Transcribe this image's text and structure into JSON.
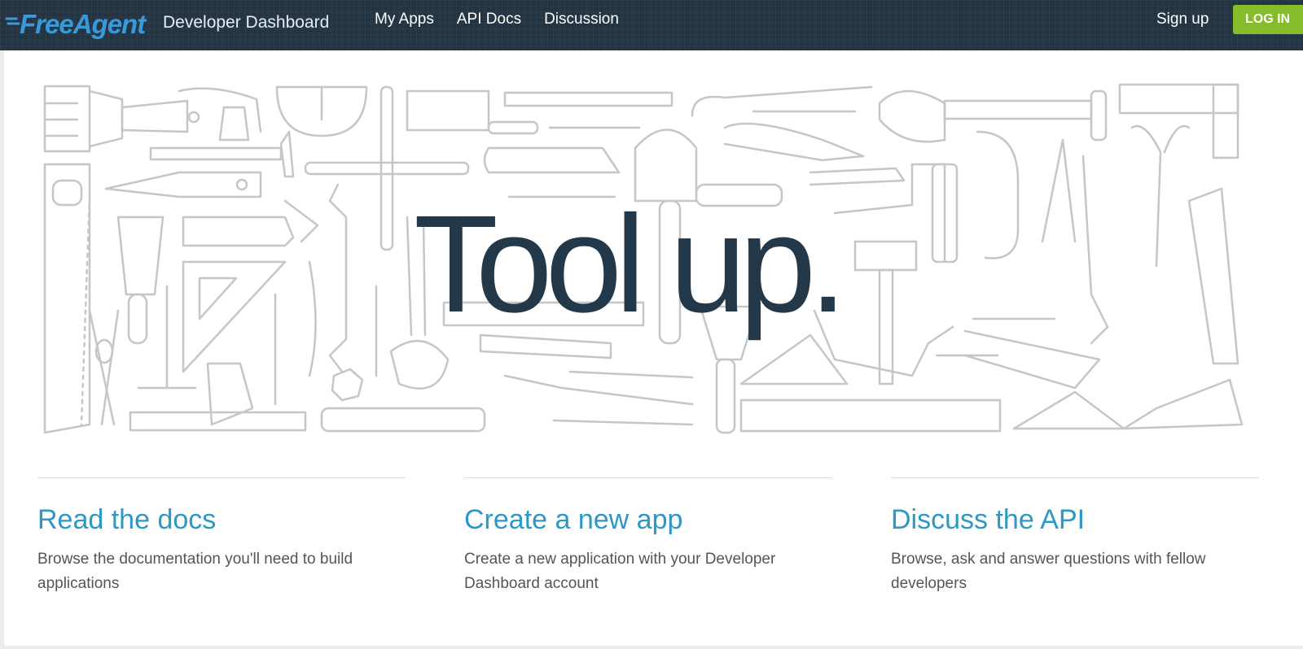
{
  "brand": {
    "logo_text": "FreeAgent",
    "subtitle": "Developer Dashboard",
    "logo_color": "#3a9ad9"
  },
  "nav": {
    "links": [
      "My Apps",
      "API Docs",
      "Discussion"
    ],
    "signup_label": "Sign up",
    "login_label": "LOG IN",
    "login_color": "#86bc2b",
    "background": "#243443"
  },
  "hero": {
    "title": "Tool up.",
    "title_color": "#23394a",
    "illustration": "hand-tools-line-drawing"
  },
  "features": [
    {
      "title": "Read the docs",
      "description": "Browse the documentation you'll need to build applications"
    },
    {
      "title": "Create a new app",
      "description": "Create a new application with your Developer Dashboard account"
    },
    {
      "title": "Discuss the API",
      "description": "Browse, ask and answer questions with fellow developers"
    }
  ],
  "colors": {
    "accent": "#2d98c6",
    "text": "#555555"
  }
}
